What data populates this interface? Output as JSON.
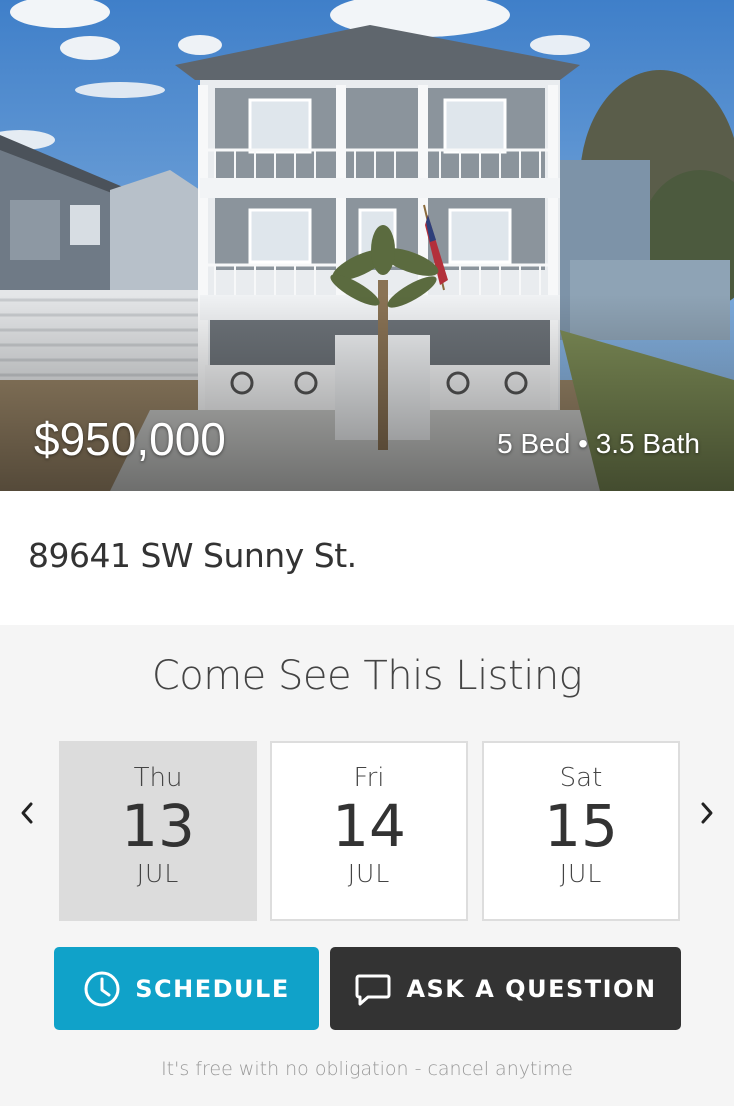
{
  "listing": {
    "price": "$950,000",
    "beds_baths": "5 Bed • 3.5 Bath",
    "address": "89641 SW Sunny St."
  },
  "schedule": {
    "title": "Come See This Listing",
    "dates": [
      {
        "dow": "Thu",
        "day": "13",
        "month": "JUL",
        "selected": true
      },
      {
        "dow": "Fri",
        "day": "14",
        "month": "JUL",
        "selected": false
      },
      {
        "dow": "Sat",
        "day": "15",
        "month": "JUL",
        "selected": false
      }
    ],
    "prev_icon": "chevron-left-icon",
    "next_icon": "chevron-right-icon"
  },
  "actions": {
    "schedule_label": "SCHEDULE",
    "schedule_icon": "clock-icon",
    "ask_label": "ASK A QUESTION",
    "ask_icon": "chat-bubble-icon",
    "disclaimer": "It's free with no obligation - cancel anytime"
  },
  "colors": {
    "schedule_button": "#10a2c9",
    "ask_button": "#333333",
    "selected_date": "#dcdcdc",
    "panel_bg": "#f5f5f5"
  }
}
